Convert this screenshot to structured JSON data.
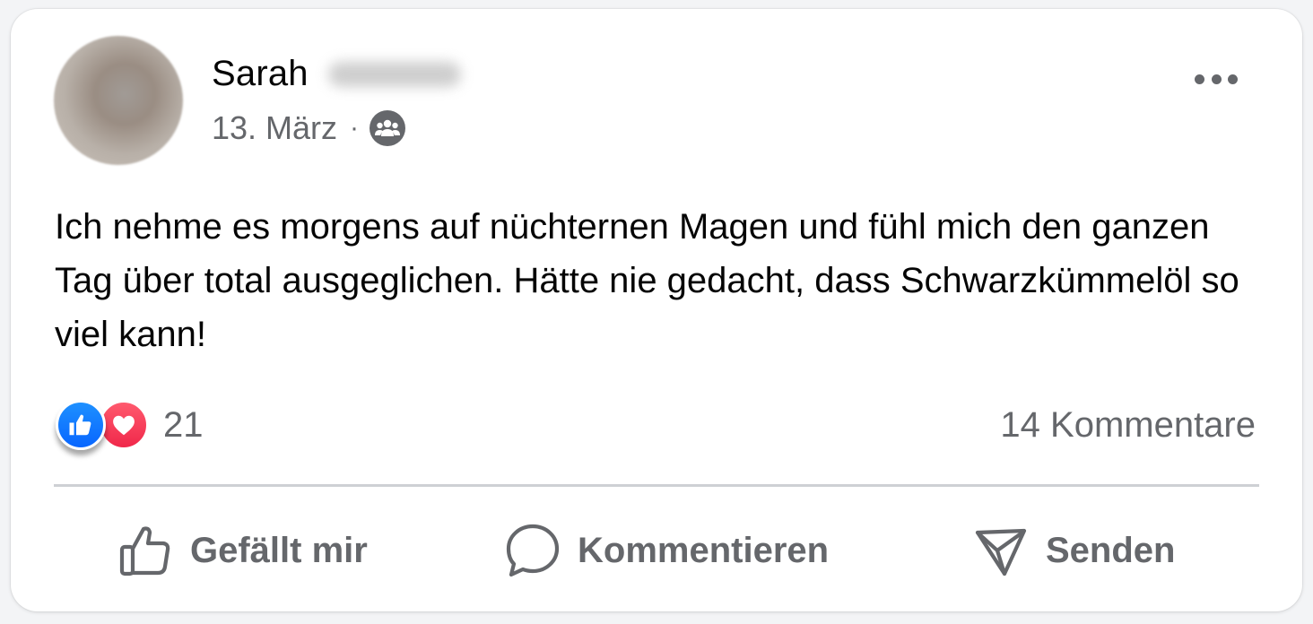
{
  "post": {
    "author_first_name": "Sarah",
    "date": "13. März",
    "separator": "·",
    "audience_icon": "friends-group-icon",
    "text": "Ich nehme es morgens auf nüchternen Magen und fühl mich den ganzen Tag über total ausgeglichen. Hätte nie gedacht, dass Schwarzkümmelöl so viel kann!",
    "reaction_count": "21",
    "reactions": [
      "like",
      "love"
    ],
    "comments_label": "14 Kommentare"
  },
  "actions": {
    "like_label": "Gefällt mir",
    "comment_label": "Kommentieren",
    "send_label": "Senden"
  },
  "colors": {
    "like_blue": "#0866ff",
    "love_red": "#f0284a",
    "secondary_text": "#65676b",
    "primary_text": "#050505"
  }
}
